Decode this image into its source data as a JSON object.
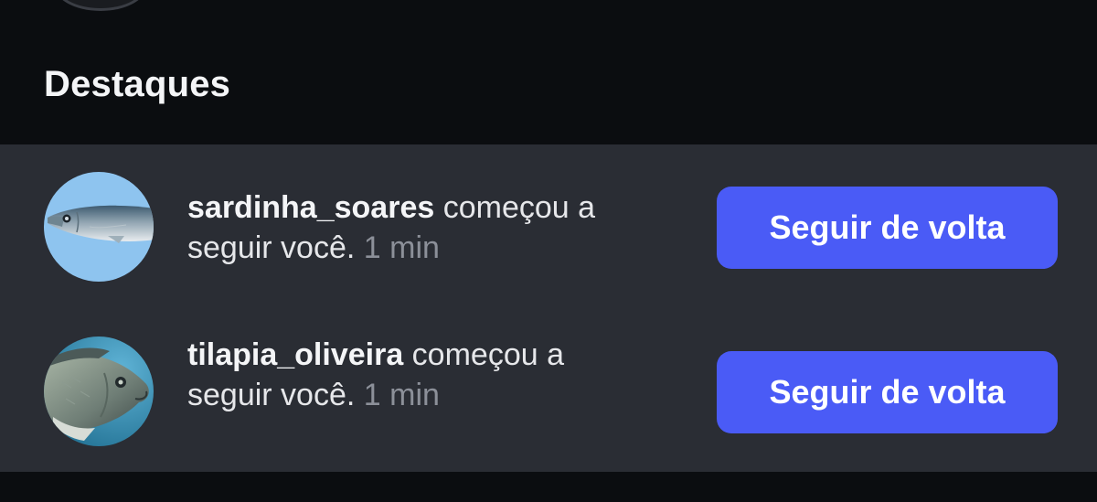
{
  "section": {
    "title": "Destaques"
  },
  "notifications": [
    {
      "username": "sardinha_soares",
      "action_line1": " começou a",
      "action_line2": "seguir você.",
      "time": " 1 min",
      "button_label": "Seguir de volta",
      "avatar_icon": "sardine-fish-avatar"
    },
    {
      "username": "tilapia_oliveira",
      "action_line1": " começou a",
      "action_line2": "seguir você.",
      "time": " 1 min",
      "button_label": "Seguir de volta",
      "avatar_icon": "tilapia-fish-avatar"
    }
  ],
  "colors": {
    "background": "#0b0d10",
    "panel": "#2a2d34",
    "accent_button": "#4a5bf6",
    "muted_text": "#8c9099"
  }
}
